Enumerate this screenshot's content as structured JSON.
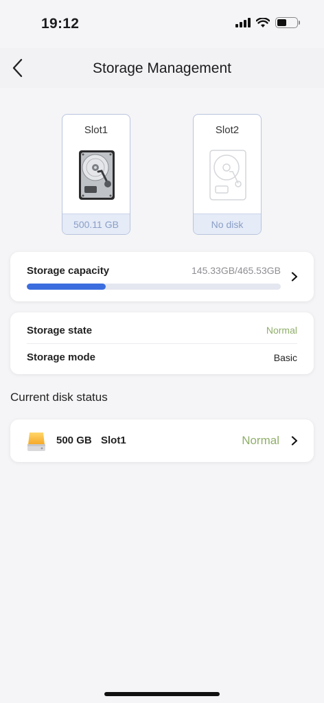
{
  "status_bar": {
    "time": "19:12"
  },
  "nav": {
    "title": "Storage Management"
  },
  "slots": [
    {
      "name": "Slot1",
      "footer": "500.11 GB",
      "has_disk": true
    },
    {
      "name": "Slot2",
      "footer": "No disk",
      "has_disk": false
    }
  ],
  "capacity": {
    "label": "Storage capacity",
    "value": "145.33GB/465.53GB",
    "used_fraction": 0.312
  },
  "state": {
    "state_label": "Storage state",
    "state_value": "Normal",
    "mode_label": "Storage mode",
    "mode_value": "Basic"
  },
  "disk_section": {
    "title": "Current disk status"
  },
  "disk": {
    "size": "500 GB",
    "slot": "Slot1",
    "status": "Normal"
  },
  "colors": {
    "accent": "#3b6ddf",
    "status_ok": "#8fae6a",
    "slot_border": "#b8c4de"
  },
  "icons": [
    "signal-icon",
    "wifi-icon",
    "battery-icon",
    "back-chevron-icon",
    "hard-drive-icon",
    "chevron-right-icon",
    "disk-icon"
  ]
}
